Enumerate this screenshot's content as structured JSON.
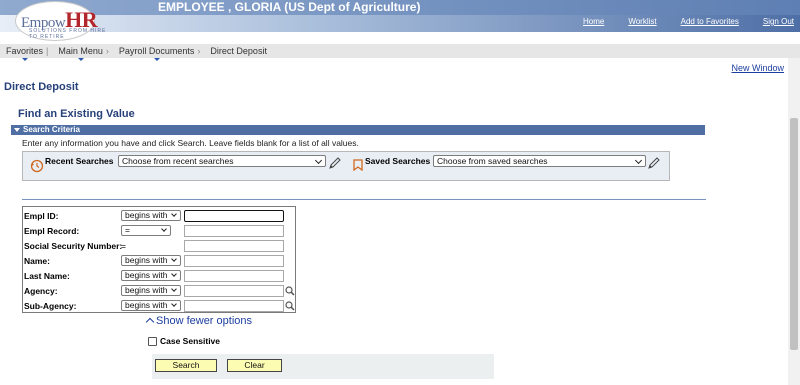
{
  "header": {
    "title": "EMPLOYEE , GLORIA (US Dept of Agriculture)",
    "logo": {
      "text_main": "Empow",
      "text_accent": "HR",
      "tagline": "SOLUTIONS FROM HIRE TO RETIRE"
    },
    "links": [
      "Home",
      "Worklist",
      "Add to Favorites",
      "Sign Out"
    ]
  },
  "breadcrumb": {
    "items": [
      "Favorites",
      "Main Menu",
      "Payroll Documents",
      "Direct Deposit"
    ]
  },
  "page": {
    "new_window": "New Window",
    "title": "Direct Deposit",
    "find_title": "Find an Existing Value",
    "criteria_label": "Search Criteria",
    "instructions": "Enter any information you have and click Search. Leave fields blank for a list of all values."
  },
  "searches": {
    "recent_label": "Recent Searches",
    "recent_value": "Choose from recent searches",
    "saved_label": "Saved Searches",
    "saved_value": "Choose from saved searches"
  },
  "fields": [
    {
      "label": "Empl ID:",
      "operator": "begins with",
      "value": "",
      "lookup": false,
      "focused": true
    },
    {
      "label": "Empl Record:",
      "operator": "=",
      "value": "",
      "lookup": false,
      "focused": false
    },
    {
      "label": "Social Security Number:",
      "operator": "=",
      "value": "",
      "lookup": false,
      "focused": false,
      "static_op": true
    },
    {
      "label": "Name:",
      "operator": "begins with",
      "value": "",
      "lookup": false,
      "focused": false
    },
    {
      "label": "Last Name:",
      "operator": "begins with",
      "value": "",
      "lookup": false,
      "focused": false
    },
    {
      "label": "Agency:",
      "operator": "begins with",
      "value": "",
      "lookup": true,
      "focused": false
    },
    {
      "label": "Sub-Agency:",
      "operator": "begins with",
      "value": "",
      "lookup": true,
      "focused": false
    }
  ],
  "options": {
    "show_fewer": "Show fewer options",
    "case_sensitive": "Case Sensitive",
    "case_checked": false
  },
  "buttons": {
    "search": "Search",
    "clear": "Clear"
  },
  "colors": {
    "nav_blue": "#4f6ea3",
    "link_blue": "#1c3ea0",
    "button_yellow": "#fdfcb3",
    "title_blue": "#26407a"
  },
  "icons": [
    "recent-searches-icon",
    "saved-searches-icon",
    "pencil-icon",
    "lookup-icon",
    "chevron-down-icon",
    "chevron-up-icon"
  ]
}
